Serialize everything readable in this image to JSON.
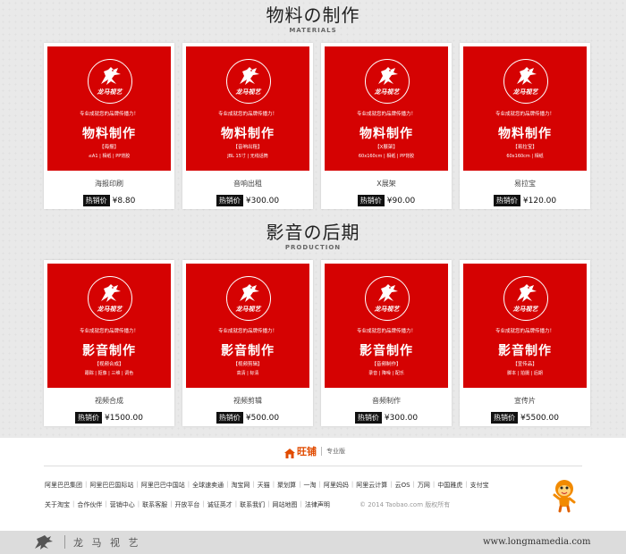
{
  "section1": {
    "title": "物料の制作",
    "subtitle": "MATERIALS",
    "cards": [
      {
        "brand": "龙马视艺",
        "slogan": "专业成就您的品牌传播力！",
        "heading": "物料制作",
        "sub": "【海报】",
        "specs": "≤A1 | 相纸 | PP背胶",
        "name": "海报印刷",
        "tag": "热销价",
        "price": "¥8.80"
      },
      {
        "brand": "龙马视艺",
        "slogan": "专业成就您的品牌传播力！",
        "heading": "物料制作",
        "sub": "【音响出租】",
        "specs": "JBL 15寸 | 无线话筒",
        "name": "音响出租",
        "tag": "热销价",
        "price": "¥300.00"
      },
      {
        "brand": "龙马视艺",
        "slogan": "专业成就您的品牌传播力！",
        "heading": "物料制作",
        "sub": "【X展架】",
        "specs": "60x160cm | 相纸 | PP背胶",
        "name": "X展架",
        "tag": "热销价",
        "price": "¥90.00"
      },
      {
        "brand": "龙马视艺",
        "slogan": "专业成就您的品牌传播力！",
        "heading": "物料制作",
        "sub": "【易拉宝】",
        "specs": "60x160cm | 相纸",
        "name": "易拉宝",
        "tag": "热销价",
        "price": "¥120.00"
      }
    ]
  },
  "section2": {
    "title": "影音の后期",
    "subtitle": "PRODUCTION",
    "cards": [
      {
        "brand": "龙马视艺",
        "slogan": "专业成就您的品牌传播力！",
        "heading": "影音制作",
        "sub": "【视频合成】",
        "specs": "跟踪 | 抠像 | 三维 | 调色",
        "name": "视频合成",
        "tag": "热销价",
        "price": "¥1500.00"
      },
      {
        "brand": "龙马视艺",
        "slogan": "专业成就您的品牌传播力！",
        "heading": "影音制作",
        "sub": "【视频剪辑】",
        "specs": "高清 | 标清",
        "name": "视频剪辑",
        "tag": "热销价",
        "price": "¥500.00"
      },
      {
        "brand": "龙马视艺",
        "slogan": "专业成就您的品牌传播力！",
        "heading": "影音制作",
        "sub": "【音频制作】",
        "specs": "录音 | 降噪 | 配乐",
        "name": "音频制作",
        "tag": "热销价",
        "price": "¥300.00"
      },
      {
        "brand": "龙马视艺",
        "slogan": "专业成就您的品牌传播力！",
        "heading": "影音制作",
        "sub": "【宣传品】",
        "specs": "脚本 | 拍摄 | 后期",
        "name": "宣传片",
        "tag": "热销价",
        "price": "¥5500.00"
      }
    ]
  },
  "footer": {
    "brand": "旺铺",
    "edition": "专业版",
    "links_row1": [
      "阿里巴巴集团",
      "阿里巴巴国际站",
      "阿里巴巴中国站",
      "全球速卖通",
      "淘宝网",
      "天猫",
      "聚划算",
      "一淘",
      "阿里妈妈",
      "阿里云计算",
      "云OS",
      "万网",
      "中国雅虎",
      "支付宝"
    ],
    "links_row2": [
      "关于淘宝",
      "合作伙伴",
      "营销中心",
      "联系客服",
      "开放平台",
      "诚征英才",
      "联系我们",
      "网站地图",
      "法律声明"
    ],
    "copyright": "© 2014 Taobao.com 版权所有"
  },
  "bottom_bar": {
    "name": "龙 马 视 艺",
    "url": "www.longmamedia.com"
  },
  "colors": {
    "banner_red": "#d50202",
    "price_tag_bg": "#111111",
    "wangpu_orange": "#e14b00"
  }
}
